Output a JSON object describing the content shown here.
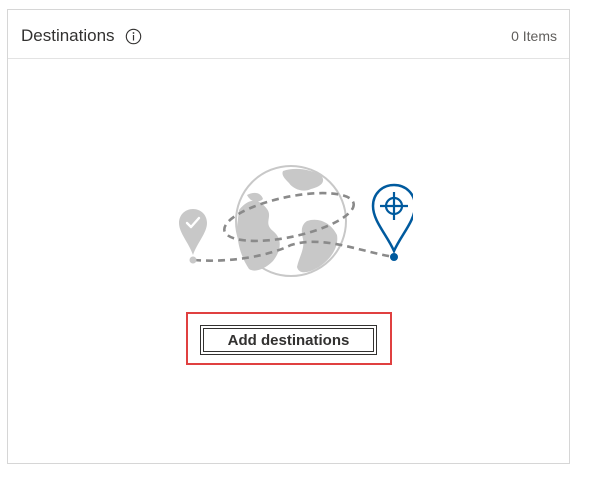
{
  "panel": {
    "title": "Destinations",
    "item_count": "0 Items"
  },
  "empty_state": {
    "add_button_label": "Add destinations"
  },
  "icons": {
    "info": "info-icon",
    "illustration": "globe-route-illustration",
    "start_pin": "checkmark-pin-icon",
    "end_pin": "target-pin-icon"
  },
  "colors": {
    "accent": "#005a9e",
    "gray_illustration": "#c8c8c8",
    "highlight": "#e04040",
    "text": "#323130"
  }
}
